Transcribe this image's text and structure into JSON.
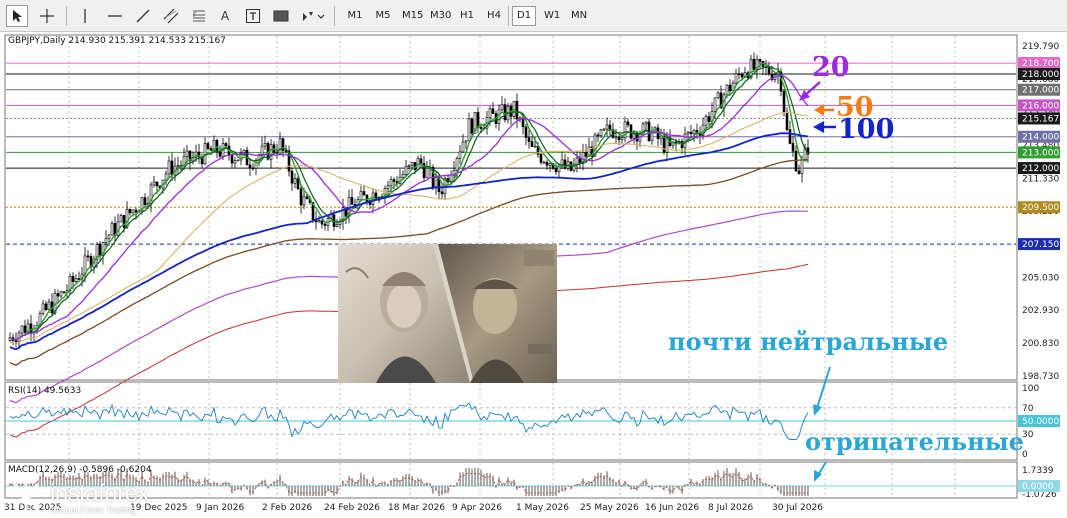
{
  "toolbar": {
    "tools": [
      {
        "name": "cursor-icon"
      },
      {
        "name": "crosshair-icon"
      },
      {
        "name": "vertical-line-icon"
      },
      {
        "name": "horizontal-line-icon"
      },
      {
        "name": "trendline-icon"
      },
      {
        "name": "equidistant-channel-icon"
      },
      {
        "name": "fibonacci-icon"
      },
      {
        "name": "text-icon",
        "label": "A"
      },
      {
        "name": "text-label-icon"
      },
      {
        "name": "rectangle-icon"
      },
      {
        "name": "arrows-icon"
      }
    ],
    "timeframes": [
      "M1",
      "M5",
      "M15",
      "M30",
      "H1",
      "H4",
      "D1",
      "W1",
      "MN"
    ],
    "active_timeframe": "D1"
  },
  "chart": {
    "symbol_line": "GBPJPY,Daily  214.930 215.391 214.533 215.167",
    "rsi_line": "RSI(14) 49.5633",
    "macd_line": "MACD(12,26,9) -0.5896 -0.6204",
    "price_axis": [
      "219.790",
      "217.680",
      "215.580",
      "213.480",
      "211.330",
      "209.250",
      "207.150",
      "205.030",
      "202.930",
      "200.830",
      "198.730"
    ],
    "price_tags": [
      {
        "label": "218.700",
        "color": "#e066c8"
      },
      {
        "label": "218.000",
        "color": "#1a1a1a"
      },
      {
        "label": "217.000",
        "color": "#6f6f6f"
      },
      {
        "label": "216.000",
        "color": "#c656c6"
      },
      {
        "label": "215.167",
        "color": "#1a1a1a"
      },
      {
        "label": "214.000",
        "color": "#7070a8"
      },
      {
        "label": "213.000",
        "color": "#2e9e2e"
      },
      {
        "label": "212.000",
        "color": "#1a1a1a"
      },
      {
        "label": "209.500",
        "color": "#b08a1e"
      },
      {
        "label": "207.150",
        "color": "#1a2fb0"
      }
    ],
    "rsi_axis": [
      "100",
      "70",
      "30",
      "0"
    ],
    "rsi_tag": "50.0000",
    "macd_axis": [
      "1.7339",
      "0.0000",
      "-1.0726"
    ],
    "date_axis": [
      "31 Dec 2025",
      "19 Dec 2025",
      "9 Jan 2026",
      "2 Feb 2026",
      "24 Feb 2026",
      "18 Mar 2026",
      "9 Apr 2026",
      "1 May 2026",
      "25 May 2026",
      "16 Jun 2026",
      "8 Jul 2026",
      "30 Jul 2026"
    ]
  },
  "annotations": {
    "ma20": "20",
    "ma50": "50",
    "ma100": "100",
    "neutral": "почти нейтральные",
    "negative": "отрицательные",
    "color_ma20": "#9c2be0",
    "color_ma50": "#f37b12",
    "color_ma100": "#1223c9",
    "color_text": "#2aa6d6"
  },
  "watermark": {
    "brand": "instaforex",
    "sub": "Instant Forex Trading"
  }
}
